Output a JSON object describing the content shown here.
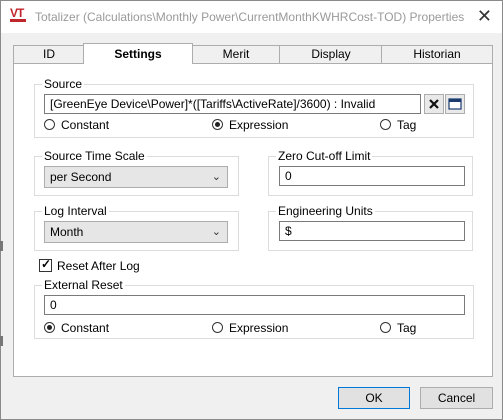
{
  "window": {
    "title": "Totalizer (Calculations\\Monthly Power\\CurrentMonthKWHRCost-TOD) Properties",
    "logo_text": "VT"
  },
  "tabs": [
    {
      "label": "ID",
      "active": false
    },
    {
      "label": "Settings",
      "active": true
    },
    {
      "label": "Merit",
      "active": false
    },
    {
      "label": "Display",
      "active": false
    },
    {
      "label": "Historian",
      "active": false
    }
  ],
  "source": {
    "label": "Source",
    "value": "[GreenEye Device\\Power]*([Tariffs\\ActiveRate]/3600) : Invalid",
    "radios": [
      {
        "label": "Constant",
        "selected": false
      },
      {
        "label": "Expression",
        "selected": true
      },
      {
        "label": "Tag",
        "selected": false
      }
    ],
    "clear_icon": "close-icon",
    "browse_icon": "window-icon"
  },
  "source_time_scale": {
    "label": "Source Time Scale",
    "value": "per Second"
  },
  "zero_cutoff": {
    "label": "Zero Cut-off Limit",
    "value": "0"
  },
  "log_interval": {
    "label": "Log Interval",
    "value": "Month"
  },
  "engineering_units": {
    "label": "Engineering Units",
    "value": "$"
  },
  "reset_after_log": {
    "label": "Reset After Log",
    "checked": true
  },
  "external_reset": {
    "label": "External Reset",
    "value": "0",
    "radios": [
      {
        "label": "Constant",
        "selected": true
      },
      {
        "label": "Expression",
        "selected": false
      },
      {
        "label": "Tag",
        "selected": false
      }
    ]
  },
  "buttons": {
    "ok": "OK",
    "cancel": "Cancel"
  }
}
